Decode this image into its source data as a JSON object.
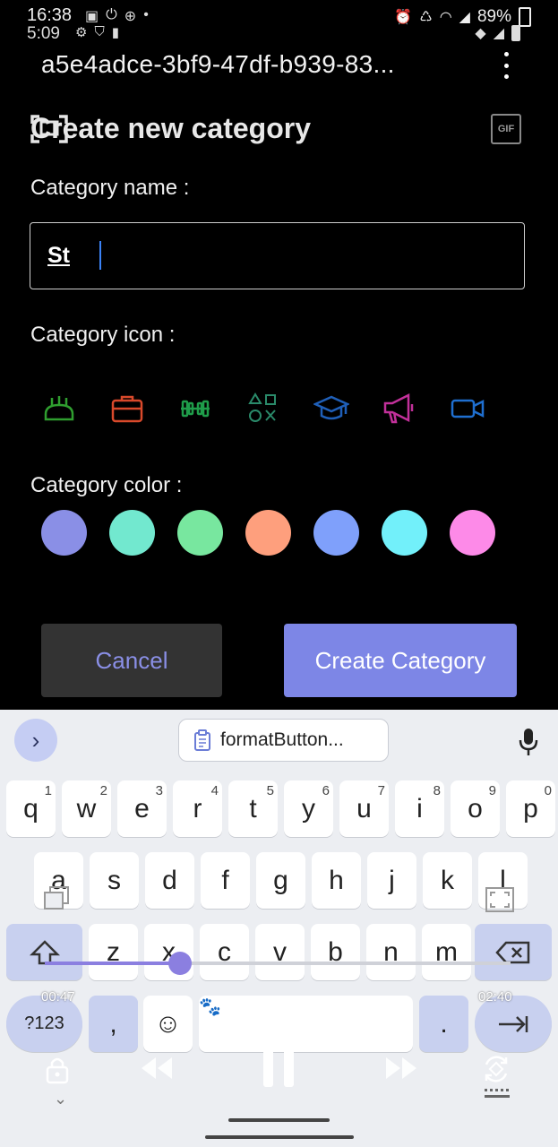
{
  "status_bar": {
    "time": "16:38",
    "time_secondary": "5:09",
    "battery": "89%"
  },
  "app_bar": {
    "title": "a5e4adce-3bf9-47df-b939-83..."
  },
  "dialog": {
    "heading": "Create new category",
    "name_label": "Category name :",
    "name_value": "St",
    "icon_label": "Category icon :",
    "icons": [
      {
        "name": "bread-icon",
        "color": "#2f9e2f"
      },
      {
        "name": "briefcase-icon",
        "color": "#d9492b"
      },
      {
        "name": "dumbbell-icon",
        "color": "#1f9d4a"
      },
      {
        "name": "game-shapes-icon",
        "color": "#2a8a6a"
      },
      {
        "name": "graduation-cap-icon",
        "color": "#1f5fb8"
      },
      {
        "name": "megaphone-icon",
        "color": "#c2309a"
      },
      {
        "name": "video-camera-icon",
        "color": "#1f6fd0"
      }
    ],
    "color_label": "Category color :",
    "colors": [
      "#8a8fe6",
      "#72e8cf",
      "#78e79f",
      "#fe9f7d",
      "#7fa0fb",
      "#72f0fa",
      "#fd8ae8"
    ],
    "cancel_label": "Cancel",
    "create_label": "Create Category"
  },
  "keyboard": {
    "clipboard_chip": "formatButton...",
    "row1": [
      {
        "k": "q",
        "n": "1"
      },
      {
        "k": "w",
        "n": "2"
      },
      {
        "k": "e",
        "n": "3"
      },
      {
        "k": "r",
        "n": "4"
      },
      {
        "k": "t",
        "n": "5"
      },
      {
        "k": "y",
        "n": "6"
      },
      {
        "k": "u",
        "n": "7"
      },
      {
        "k": "i",
        "n": "8"
      },
      {
        "k": "o",
        "n": "9"
      },
      {
        "k": "p",
        "n": "0"
      }
    ],
    "row2": [
      "a",
      "s",
      "d",
      "f",
      "g",
      "h",
      "j",
      "k",
      "l"
    ],
    "row3": [
      "z",
      "x",
      "c",
      "v",
      "b",
      "n",
      "m"
    ],
    "symbols_label": "?123",
    "comma_label": ",",
    "period_label": "."
  },
  "media": {
    "elapsed": "00:47",
    "total": "02:40",
    "progress": 0.29
  }
}
